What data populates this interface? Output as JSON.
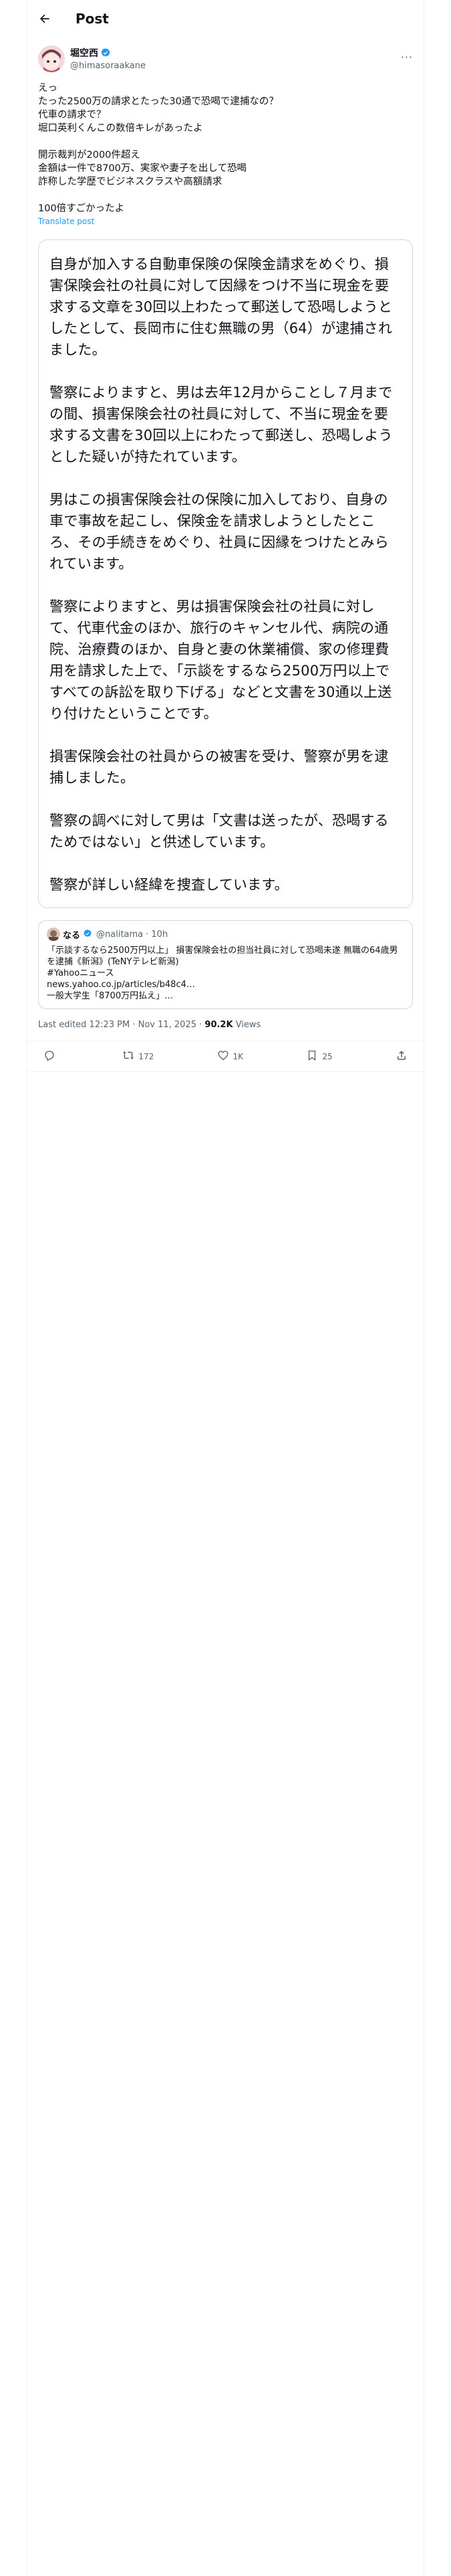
{
  "header": {
    "title": "Post"
  },
  "author": {
    "name": "堀空西",
    "handle": "@himasoraakane"
  },
  "tweet": {
    "text": "えっ\nたった2500万の請求とたった30通で恐喝で逮捕なの？\n代車の請求で？\n堀口英利くんこの数倍キレがあったよ\n\n開示裁判が2000件超え\n金額は一件で8700万、実家や妻子を出して恐喝\n詐称した学歴でビジネスクラスや高額請求\n\n100倍すごかったよ",
    "translate_label": "Translate post"
  },
  "quote": {
    "paragraphs": [
      "自身が加入する自動車保険の保険金請求をめぐり、損害保険会社の社員に対して因縁をつけ不当に現金を要求する文章を30回以上わたって郵送して恐喝しようとしたとして、長岡市に住む無職の男（64）が逮捕されました。",
      "警察によりますと、男は去年12月からことし７月までの間、損害保険会社の社員に対して、不当に現金を要求する文書を30回以上にわたって郵送し、恐喝しようとした疑いが持たれています。",
      "男はこの損害保険会社の保険に加入しており、自身の車で事故を起こし、保険金を請求しようとしたところ、その手続きをめぐり、社員に因縁をつけたとみられています。",
      "警察によりますと、男は損害保険会社の社員に対して、代車代金のほか、旅行のキャンセル代、病院の通院、治療費のほか、自身と妻の休業補償、家の修理費用を請求した上で、「示談をするなら2500万円以上ですべての訴訟を取り下げる」などと文書を30通以上送り付けたということです。",
      "損害保険会社の社員からの被害を受け、警察が男を逮捕しました。",
      "警察の調べに対して男は「文書は送ったが、恐喝するためではない」と供述しています。",
      "警察が詳しい経緯を捜査しています。"
    ]
  },
  "embed": {
    "name": "なる",
    "handle": "@nalitama",
    "time": "· 10h",
    "body": "「示談するなら2500万円以上」 損害保険会社の担当社員に対して恐喝未遂 無職の64歳男を逮捕《新潟》(TeNYテレビ新潟)\n#Yahooニュース\nnews.yahoo.co.jp/articles/b48c4…\n一般大学生「8700万円払え」…"
  },
  "meta": {
    "edited": "Last edited 12:23 PM · Nov 11, 2025 · ",
    "views_count": "90.2K",
    "views_label": " Views"
  },
  "actions": {
    "reply": "",
    "repost": "172",
    "like": "1K",
    "bookmark": "25"
  },
  "colors": {
    "accent": "#1d9bf0",
    "verified": "#1d9bf0",
    "border": "#cfd9de",
    "muted": "#536471"
  }
}
